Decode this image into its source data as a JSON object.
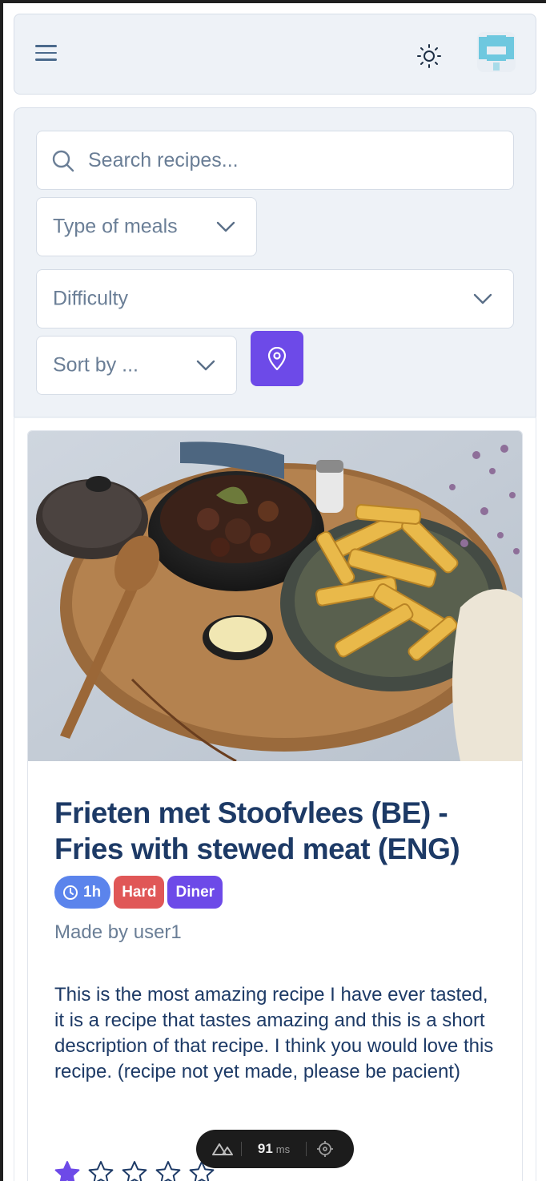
{
  "header": {
    "menu_icon": "hamburger-icon",
    "theme_icon": "sun-icon",
    "logo_icon": "app-logo"
  },
  "filters": {
    "search_placeholder": "Search recipes...",
    "meal_type_label": "Type of meals",
    "difficulty_label": "Difficulty",
    "sort_label": "Sort by ...",
    "location_icon": "map-pin-icon",
    "accent_color": "#6d4ae8"
  },
  "recipe": {
    "title": "Frieten met Stoofvlees (BE) - Fries with stewed meat (ENG)",
    "time": "1h",
    "difficulty": "Hard",
    "meal": "Diner",
    "author": "Made by user1",
    "description": "This is the most amazing recipe I have ever tasted, it is a recipe that tastes amazing and this is a short description of that recipe. I think you would love this recipe. (recipe not yet made, please be pacient)",
    "rating": 1,
    "rating_max": 5,
    "colors": {
      "time": "#5b84ec",
      "hard": "#e05757",
      "diner": "#6d4ae8",
      "title": "#1d3a66"
    }
  },
  "devtools": {
    "time_value": "91",
    "time_unit": "ms"
  }
}
